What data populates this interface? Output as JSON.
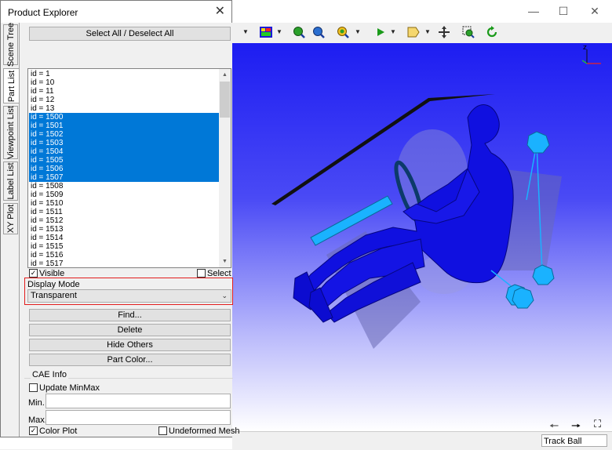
{
  "dialog": {
    "title": "Product Explorer",
    "tabs": [
      "Scene Tree",
      "Part List",
      "Viewpoint List",
      "Label List",
      "XY Plot"
    ],
    "select_all_label": "Select All / Deselect All",
    "parts": [
      {
        "label": "id = 1",
        "selected": false
      },
      {
        "label": "id = 10",
        "selected": false
      },
      {
        "label": "id = 11",
        "selected": false
      },
      {
        "label": "id = 12",
        "selected": false
      },
      {
        "label": "id = 13",
        "selected": false
      },
      {
        "label": "id = 1500",
        "selected": true
      },
      {
        "label": "id = 1501",
        "selected": true
      },
      {
        "label": "id = 1502",
        "selected": true
      },
      {
        "label": "id = 1503",
        "selected": true
      },
      {
        "label": "id = 1504",
        "selected": true
      },
      {
        "label": "id = 1505",
        "selected": true
      },
      {
        "label": "id = 1506",
        "selected": true
      },
      {
        "label": "id = 1507",
        "selected": true
      },
      {
        "label": "id = 1508",
        "selected": false
      },
      {
        "label": "id = 1509",
        "selected": false
      },
      {
        "label": "id = 1510",
        "selected": false
      },
      {
        "label": "id = 1511",
        "selected": false
      },
      {
        "label": "id = 1512",
        "selected": false
      },
      {
        "label": "id = 1513",
        "selected": false
      },
      {
        "label": "id = 1514",
        "selected": false
      },
      {
        "label": "id = 1515",
        "selected": false
      },
      {
        "label": "id = 1516",
        "selected": false
      },
      {
        "label": "id = 1517",
        "selected": false
      }
    ],
    "visible_label": "Visible",
    "visible_checked": true,
    "select_label": "Select",
    "select_checked": false,
    "display_mode_label": "Display Mode",
    "display_mode_value": "Transparent",
    "buttons": {
      "find": "Find...",
      "delete": "Delete",
      "hide_others": "Hide Others",
      "part_color": "Part Color..."
    },
    "cae_info": {
      "title": "CAE Info",
      "update_minmax_label": "Update MinMax",
      "update_minmax_checked": false,
      "min_label": "Min.",
      "max_label": "Max.",
      "min_value": "",
      "max_value": "",
      "color_plot_label": "Color Plot",
      "color_plot_checked": true,
      "undeformed_mesh_label": "Undeformed Mesh",
      "undeformed_mesh_checked": false
    }
  },
  "statusbar": {
    "mode": "Track Ball"
  },
  "colors": {
    "selection": "#0078d7",
    "highlight_border": "#e21c1c",
    "viewport_top": "#1d1df2",
    "dummy_blue": "#1010e0",
    "sensor_cyan": "#1ab2ff"
  }
}
